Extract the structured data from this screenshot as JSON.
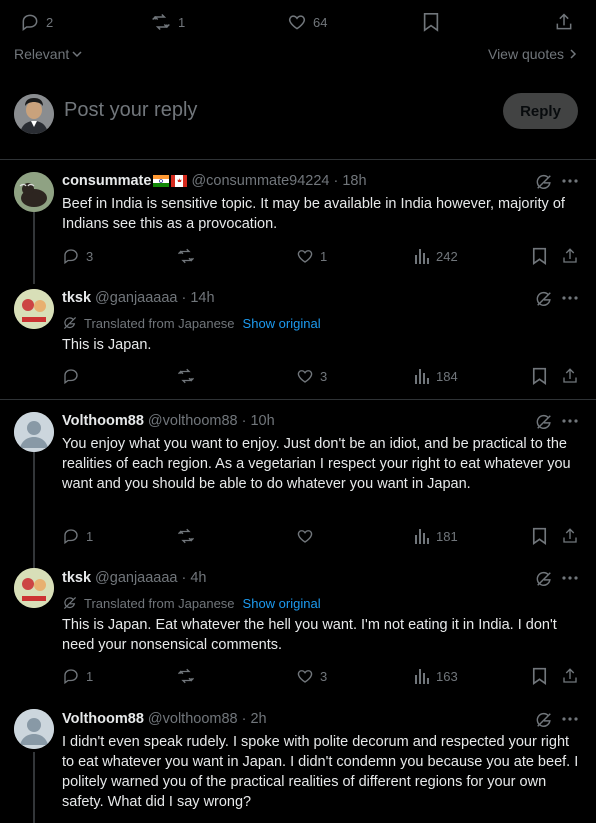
{
  "stats": {
    "replies": "2",
    "reposts": "1",
    "likes": "64"
  },
  "sort": {
    "label": "Relevant",
    "view_quotes": "View quotes"
  },
  "composer": {
    "placeholder": "Post your reply",
    "reply_button": "Reply"
  },
  "translated_label": "Translated from Japanese",
  "show_original": "Show original",
  "posts": [
    {
      "name": "consummate",
      "handle": "@consummate94224",
      "time": "18h",
      "text": "Beef in India is sensitive topic. It may be available in India however, majority of Indians see this as a provocation.",
      "replies": "3",
      "reposts": "",
      "likes": "1",
      "views": "242"
    },
    {
      "name": "tksk",
      "handle": "@ganjaaaaa",
      "time": "14h",
      "text": "This is Japan.",
      "replies": "",
      "reposts": "",
      "likes": "3",
      "views": "184"
    },
    {
      "name": "Volthoom88",
      "handle": "@volthoom88",
      "time": "10h",
      "text": "You enjoy what you want to enjoy. Just don't be an idiot, and be practical to the realities of each region. As a vegetarian I respect your right to eat whatever you want and you should be able to do whatever you want in Japan.",
      "replies": "1",
      "reposts": "",
      "likes": "",
      "views": "181"
    },
    {
      "name": "tksk",
      "handle": "@ganjaaaaa",
      "time": "4h",
      "text": "This is Japan. Eat whatever the hell you want. I'm not eating it in India. I don't need your nonsensical comments.",
      "replies": "1",
      "reposts": "",
      "likes": "3",
      "views": "163"
    },
    {
      "name": "Volthoom88",
      "handle": "@volthoom88",
      "time": "2h",
      "text": "I didn't even speak rudely. I spoke with polite decorum and respected your right to eat whatever you want in Japan. I didn't condemn you because you ate beef. I politely warned you of the practical realities of different regions for your own safety. What did I say wrong?"
    }
  ],
  "separator": "·",
  "colors": {
    "background": "#000000",
    "text": "#e7e9ea",
    "muted": "#71767b",
    "link": "#1d9bf0",
    "border": "#2f3336"
  }
}
